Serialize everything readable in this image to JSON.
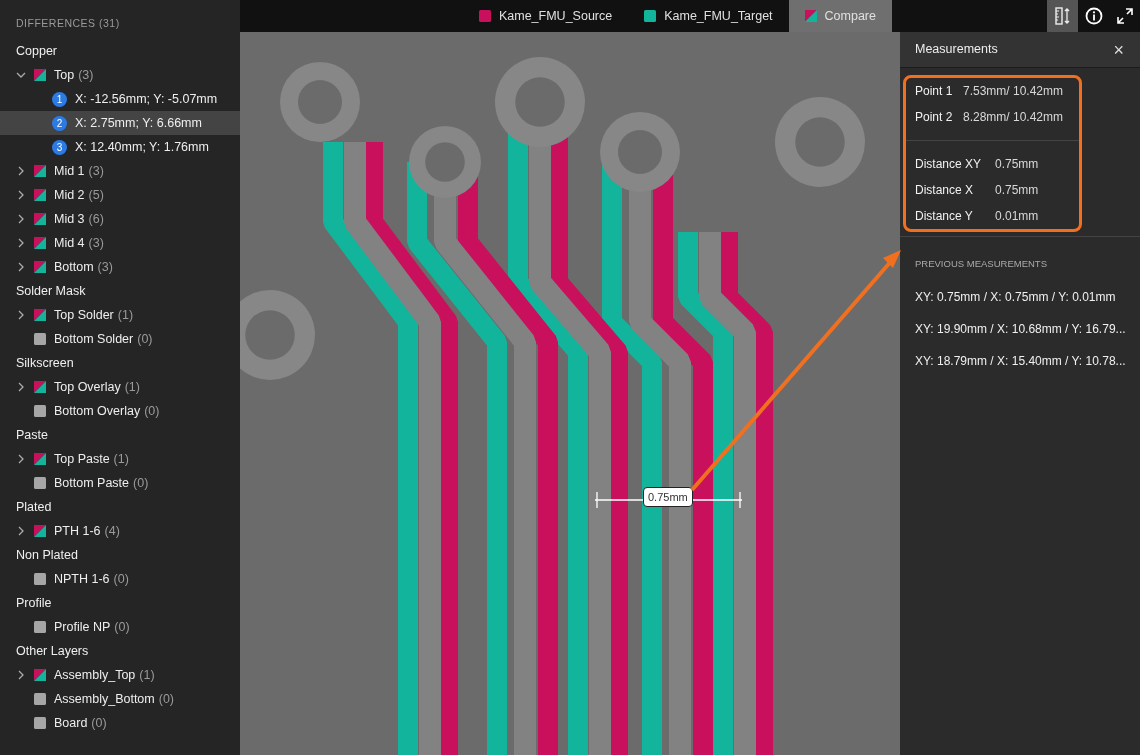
{
  "sidebar": {
    "title": "DIFFERENCES (31)",
    "groups": [
      {
        "label": "Copper",
        "layers": [
          {
            "name": "Top",
            "count": "(3)",
            "kind": "diff",
            "expanded": true,
            "points": [
              {
                "index": "1",
                "label": "X: -12.56mm; Y: -5.07mm",
                "selected": false
              },
              {
                "index": "2",
                "label": "X: 2.75mm; Y: 6.66mm",
                "selected": true
              },
              {
                "index": "3",
                "label": "X: 12.40mm; Y: 1.76mm",
                "selected": false
              }
            ]
          },
          {
            "name": "Mid 1",
            "count": "(3)",
            "kind": "diff",
            "expanded": false
          },
          {
            "name": "Mid 2",
            "count": "(5)",
            "kind": "diff",
            "expanded": false
          },
          {
            "name": "Mid 3",
            "count": "(6)",
            "kind": "diff",
            "expanded": false
          },
          {
            "name": "Mid 4",
            "count": "(3)",
            "kind": "diff",
            "expanded": false
          },
          {
            "name": "Bottom",
            "count": "(3)",
            "kind": "diff",
            "expanded": false
          }
        ]
      },
      {
        "label": "Solder Mask",
        "layers": [
          {
            "name": "Top Solder",
            "count": "(1)",
            "kind": "diff",
            "expanded": false
          },
          {
            "name": "Bottom Solder",
            "count": "(0)",
            "kind": "same"
          }
        ]
      },
      {
        "label": "Silkscreen",
        "layers": [
          {
            "name": "Top Overlay",
            "count": "(1)",
            "kind": "diff",
            "expanded": false
          },
          {
            "name": "Bottom Overlay",
            "count": "(0)",
            "kind": "same"
          }
        ]
      },
      {
        "label": "Paste",
        "layers": [
          {
            "name": "Top Paste",
            "count": "(1)",
            "kind": "diff",
            "expanded": false
          },
          {
            "name": "Bottom Paste",
            "count": "(0)",
            "kind": "same"
          }
        ]
      },
      {
        "label": "Plated",
        "layers": [
          {
            "name": "PTH 1-6",
            "count": "(4)",
            "kind": "diff",
            "expanded": false
          }
        ]
      },
      {
        "label": "Non Plated",
        "layers": [
          {
            "name": "NPTH 1-6",
            "count": "(0)",
            "kind": "same"
          }
        ]
      },
      {
        "label": "Profile",
        "layers": [
          {
            "name": "Profile NP",
            "count": "(0)",
            "kind": "same"
          }
        ]
      },
      {
        "label": "Other Layers",
        "layers": [
          {
            "name": "Assembly_Top",
            "count": "(1)",
            "kind": "diff",
            "expanded": false
          },
          {
            "name": "Assembly_Bottom",
            "count": "(0)",
            "kind": "same"
          },
          {
            "name": "Board",
            "count": "(0)",
            "kind": "same"
          }
        ]
      }
    ]
  },
  "tabs": [
    {
      "label": "Kame_FMU_Source",
      "kind": "solid",
      "color": "#c8105c",
      "selected": false
    },
    {
      "label": "Kame_FMU_Target",
      "kind": "solid",
      "color": "#12b59c",
      "selected": false
    },
    {
      "label": "Compare",
      "kind": "split",
      "selected": true
    }
  ],
  "toolbar": [
    {
      "kind": "ruler",
      "selected": true
    },
    {
      "kind": "info",
      "selected": false
    },
    {
      "kind": "fullscreen",
      "selected": false
    }
  ],
  "canvas": {
    "measurement_label": "0.75mm"
  },
  "panel": {
    "title": "Measurements",
    "close": "×",
    "points": [
      {
        "label": "Point 1",
        "value": "7.53mm/ 10.42mm"
      },
      {
        "label": "Point 2",
        "value": "8.28mm/ 10.42mm"
      }
    ],
    "distances": [
      {
        "label": "Distance XY",
        "value": "0.75mm"
      },
      {
        "label": "Distance X",
        "value": "0.75mm"
      },
      {
        "label": "Distance Y",
        "value": "0.01mm"
      }
    ],
    "previous_title": "PREVIOUS MEASUREMENTS",
    "previous": [
      "XY: 0.75mm / X: 0.75mm / Y: 0.01mm",
      "XY: 19.90mm / X: 10.68mm / Y: 16.79...",
      "XY: 18.79mm / X: 15.40mm / Y: 10.78..."
    ]
  }
}
